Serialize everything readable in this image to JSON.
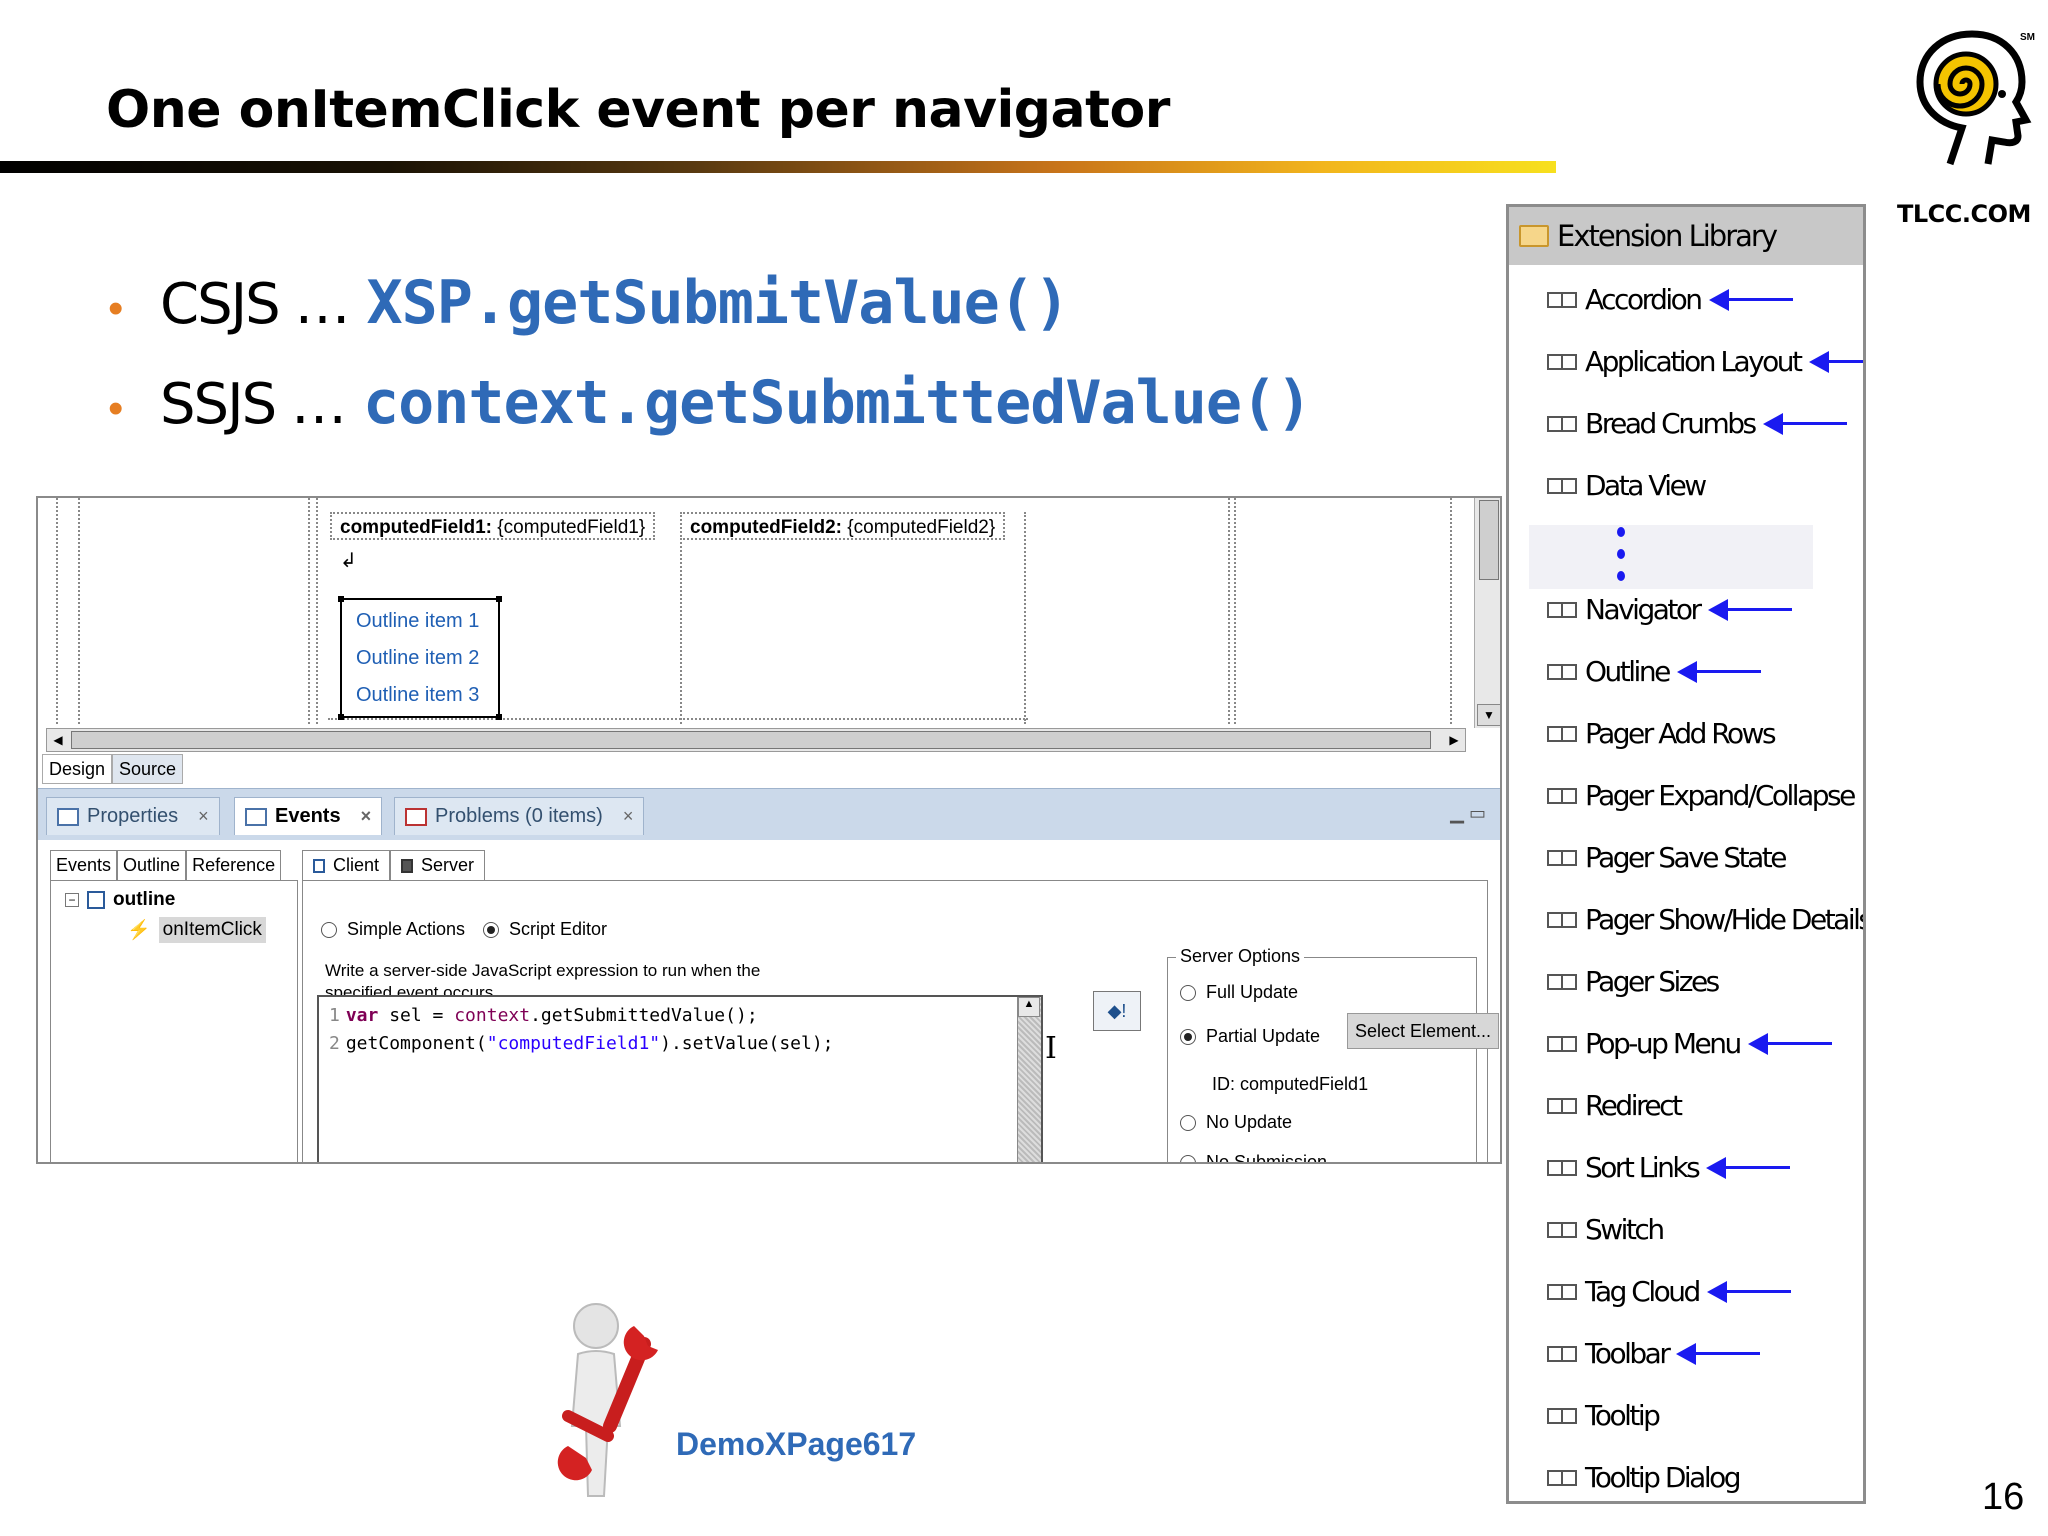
{
  "slide": {
    "title": "One onItemClick event per navigator",
    "page_number": "16",
    "logo_text": "TLCC.COM",
    "logo_mark": "SM"
  },
  "bullets": [
    {
      "label": "CSJS …",
      "code": "XSP.getSubmitValue()"
    },
    {
      "label": "SSJS …",
      "code": "context.getSubmittedValue()"
    }
  ],
  "designer": {
    "computed_field_1": {
      "name": "computedField1:",
      "value": "{computedField1}"
    },
    "computed_field_2": {
      "name": "computedField2:",
      "value": "{computedField2}"
    },
    "outline_items": [
      "Outline item 1",
      "Outline item 2",
      "Outline item 3"
    ],
    "mode_tabs": [
      "Design",
      "Source"
    ],
    "view_tabs": [
      "Properties",
      "Events",
      "Problems (0 items)"
    ],
    "left_tabs": [
      "Events",
      "Outline",
      "Reference"
    ],
    "tree": {
      "root": "outline",
      "child": "onItemClick"
    },
    "client_server_tabs": [
      "Client",
      "Server"
    ],
    "action_options": {
      "simple": "Simple Actions",
      "script": "Script Editor"
    },
    "instructions": [
      "Write a server-side JavaScript expression to run when the",
      "specified event occurs."
    ],
    "code": {
      "line1_num": "1",
      "line1_kw": "var",
      "line1_rest": " sel = ",
      "line1_fn": "context",
      "line1_end": ".getSubmittedValue();",
      "line2_num": "2",
      "line2_a": "getComponent(",
      "line2_str": "\"computedField1\"",
      "line2_b": ").setValue(sel);"
    },
    "server_options": {
      "legend": "Server Options",
      "full": "Full Update",
      "partial": "Partial Update",
      "select_button": "Select Element...",
      "id_label": "ID: computedField1",
      "none": "No Update",
      "no_submission": "No Submission"
    }
  },
  "palette": {
    "header": "Extension Library",
    "items": [
      {
        "label": "Accordion",
        "arrow": true
      },
      {
        "label": "Application Layout",
        "arrow": true
      },
      {
        "label": "Bread Crumbs",
        "arrow": true
      },
      {
        "label": "Data View",
        "arrow": false
      },
      {
        "label": "Navigator",
        "arrow": true
      },
      {
        "label": "Outline",
        "arrow": true
      },
      {
        "label": "Pager Add Rows",
        "arrow": false
      },
      {
        "label": "Pager Expand/Collapse",
        "arrow": false
      },
      {
        "label": "Pager Save State",
        "arrow": false
      },
      {
        "label": "Pager Show/Hide Details",
        "arrow": false
      },
      {
        "label": "Pager Sizes",
        "arrow": false
      },
      {
        "label": "Pop-up Menu",
        "arrow": true
      },
      {
        "label": "Redirect",
        "arrow": false
      },
      {
        "label": "Sort Links",
        "arrow": true
      },
      {
        "label": "Switch",
        "arrow": false
      },
      {
        "label": "Tag Cloud",
        "arrow": true
      },
      {
        "label": "Toolbar",
        "arrow": true
      },
      {
        "label": "Tooltip",
        "arrow": false
      },
      {
        "label": "Tooltip Dialog",
        "arrow": false
      }
    ],
    "arrow_color": "#1a1af0"
  },
  "demo": {
    "label": "DemoXPage617",
    "icon": "wrench-person-icon"
  },
  "colors": {
    "accent": "#2f6ab7",
    "bullet": "#e67e22"
  }
}
